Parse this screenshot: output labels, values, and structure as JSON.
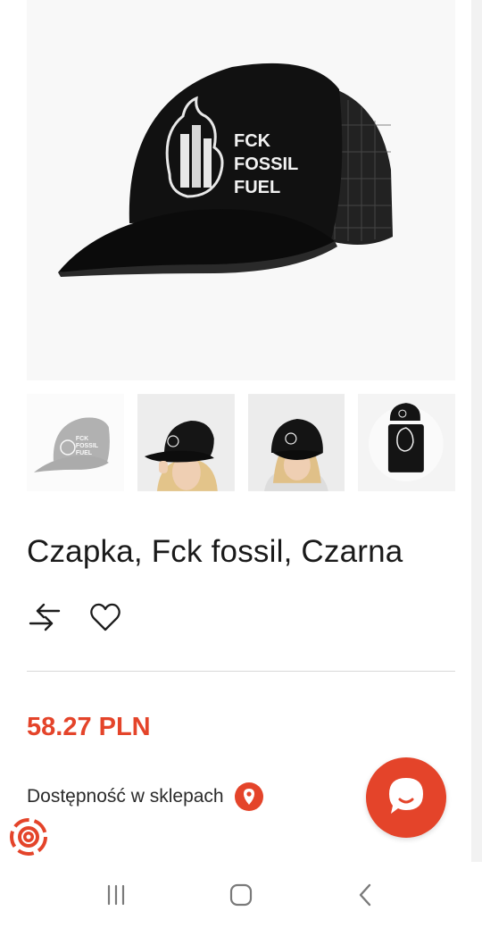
{
  "product": {
    "main_image": {
      "alt": "Czapka, Fck fossil, Czarna",
      "print_text": [
        "FCK",
        "FOSSIL",
        "FUEL"
      ]
    },
    "thumbnails": [
      {
        "name": "thumb-cap-front",
        "print_text": [
          "FCK",
          "FOSSIL",
          "FUEL"
        ]
      },
      {
        "name": "thumb-model-1"
      },
      {
        "name": "thumb-model-2"
      },
      {
        "name": "thumb-cap-hoodie"
      }
    ],
    "title": "Czapka, Fck fossil, Czarna",
    "price": "58.27 PLN"
  },
  "actions": {
    "compare_icon": "compare-arrows-icon",
    "wishlist_icon": "heart-icon"
  },
  "availability": {
    "label": "Dostępność w sklepach",
    "icon": "location-pin-icon"
  },
  "chat": {
    "icon": "chat-bubble-icon"
  },
  "colors": {
    "accent": "#e4442a",
    "text": "#1a1a1a",
    "divider": "#d8d8d8"
  },
  "system_nav": {
    "recent_icon": "recent-apps-icon",
    "home_icon": "home-icon",
    "back_icon": "back-icon"
  }
}
